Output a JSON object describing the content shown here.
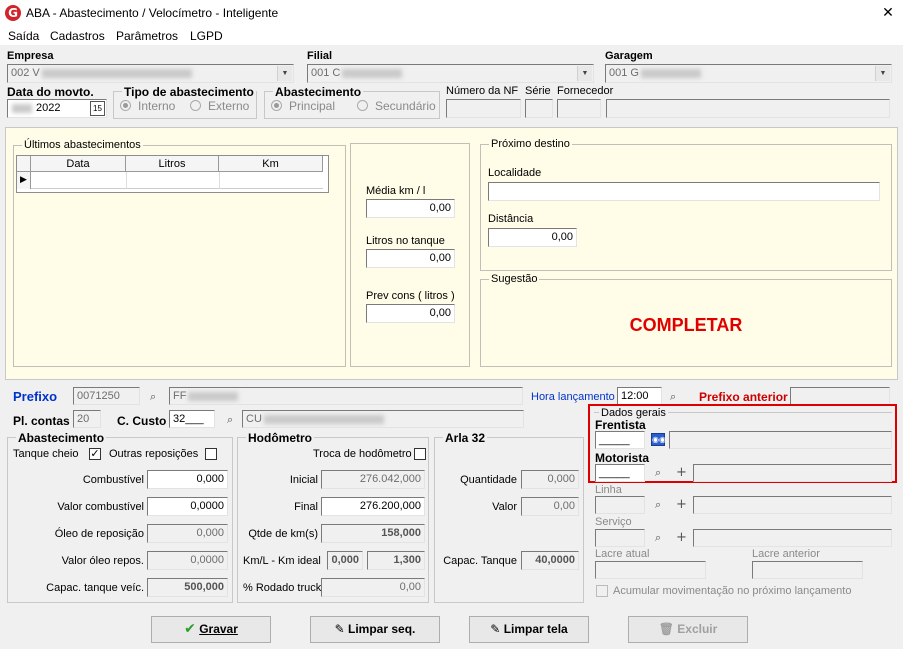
{
  "window": {
    "title": "ABA - Abastecimento / Velocímetro - Inteligente"
  },
  "menu": [
    "Saída",
    "Cadastros",
    "Parâmetros",
    "LGPD"
  ],
  "header": {
    "empresa_label": "Empresa",
    "empresa_value": "002 V",
    "filial_label": "Filial",
    "filial_value": "001 C",
    "garagem_label": "Garagem",
    "garagem_value": "001 G",
    "data_label": "Data do movto.",
    "data_value": "2022",
    "tipo_label": "Tipo de abastecimento",
    "tipo_interno": "Interno",
    "tipo_externo": "Externo",
    "abast_label": "Abastecimento",
    "abast_principal": "Principal",
    "abast_secundario": "Secundário",
    "nf_label": "Número da NF",
    "serie_label": "Série",
    "fornecedor_label": "Fornecedor"
  },
  "ultimos": {
    "title": "Últimos abastecimentos",
    "columns": [
      "Data",
      "Litros",
      "Km"
    ]
  },
  "medias": {
    "media_label": "Média km / l",
    "media_value": "0,00",
    "litros_label": "Litros no tanque",
    "litros_value": "0,00",
    "prev_label": "Prev cons ( litros )",
    "prev_value": "0,00"
  },
  "destino": {
    "title": "Próximo destino",
    "localidade_label": "Localidade",
    "distancia_label": "Distância",
    "distancia_value": "0,00"
  },
  "sugestao": {
    "title": "Sugestão",
    "text": "COMPLETAR"
  },
  "prefixo": {
    "label": "Prefixo",
    "value": "0071250",
    "desc": "FF",
    "hora_label": "Hora lançamento",
    "hora_value": "12:00",
    "anterior_label": "Prefixo anterior"
  },
  "plcontas": {
    "label": "Pl. contas",
    "value": "20",
    "custo_label": "C. Custo",
    "custo_value": "32___",
    "custo_desc": "CU"
  },
  "abastecimento": {
    "title": "Abastecimento",
    "tanque_cheio": "Tanque cheio",
    "outras": "Outras reposições",
    "combustivel_label": "Combustível",
    "combustivel_value": "0,000",
    "valor_comb_label": "Valor combustível",
    "valor_comb_value": "0,0000",
    "oleo_label": "Óleo de reposição",
    "oleo_value": "0,000",
    "valor_oleo_label": "Valor óleo repos.",
    "valor_oleo_value": "0,0000",
    "capac_label": "Capac. tanque veíc.",
    "capac_value": "500,000"
  },
  "hodometro": {
    "title": "Hodômetro",
    "troca_label": "Troca de hodômetro",
    "inicial_label": "Inicial",
    "inicial_value": "276.042,000",
    "final_label": "Final",
    "final_value": "276.200,000",
    "qtde_label": "Qtde de km(s)",
    "qtde_value": "158,000",
    "kml_label": "Km/L - Km ideal",
    "kml_value": "0,000",
    "ideal_value": "1,300",
    "rodado_label": "% Rodado truck",
    "rodado_value": "0,00"
  },
  "arla": {
    "title": "Arla 32",
    "qtde_label": "Quantidade",
    "qtde_value": "0,000",
    "valor_label": "Valor",
    "valor_value": "0,00",
    "capac_label": "Capac. Tanque",
    "capac_value": "40,0000"
  },
  "dados_gerais": {
    "title": "Dados gerais",
    "frentista_label": "Frentista",
    "frentista_value": "_____",
    "motorista_label": "Motorista",
    "motorista_value": "_____",
    "linha_label": "Linha",
    "servico_label": "Serviço",
    "lacre_atual_label": "Lacre atual",
    "lacre_anterior_label": "Lacre anterior",
    "acumular_label": "Acumular movimentação no próximo lançamento"
  },
  "buttons": {
    "gravar": "Gravar",
    "limpar_seq": "Limpar seq.",
    "limpar_tela": "Limpar tela",
    "excluir": "Excluir"
  },
  "colors": {
    "highlight": "#dd0000",
    "accent_blue": "#0033cc",
    "panel_yellow": "#fffce8"
  }
}
